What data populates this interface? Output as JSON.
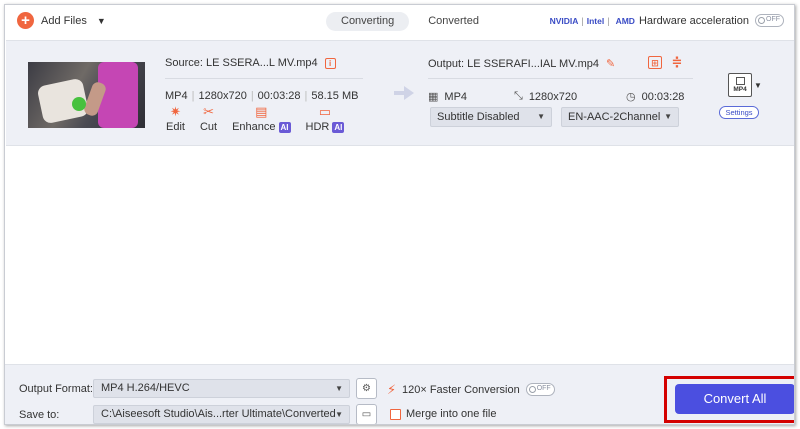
{
  "toolbar": {
    "add_files_label": "Add Files",
    "add_files_caret": "▼"
  },
  "tabs": [
    {
      "label": "Converting",
      "active": true
    },
    {
      "label": "Converted",
      "active": false
    }
  ],
  "hardware": {
    "nvidia": "NVIDIA",
    "intel": "Intel",
    "amd": "AMD",
    "label": "Hardware acceleration",
    "toggle_state": "OFF"
  },
  "file": {
    "source_label": "Source: LE SSERA...L MV.mp4",
    "format": "MP4",
    "resolution": "1280x720",
    "duration": "00:03:28",
    "size": "58.15 MB",
    "actions": [
      {
        "label": "Edit",
        "icon": "magic-wand-icon",
        "ai": false
      },
      {
        "label": "Cut",
        "icon": "scissors-icon",
        "ai": false
      },
      {
        "label": "Enhance",
        "icon": "enhance-icon",
        "ai": true
      },
      {
        "label": "HDR",
        "icon": "hdr-icon",
        "ai": true
      }
    ],
    "ai_badge": "AI",
    "output_label": "Output: LE SSERAFI...IAL MV.mp4",
    "output_format": "MP4",
    "output_resolution": "1280x720",
    "output_duration": "00:03:28",
    "subtitle": "Subtitle Disabled",
    "audio": "EN-AAC-2Channel",
    "format_badge": "MP4",
    "settings_label": "Settings"
  },
  "bottom": {
    "output_format_label": "Output Format:",
    "output_format_value": "MP4 H.264/HEVC",
    "save_to_label": "Save to:",
    "save_to_value": "C:\\Aiseesoft Studio\\Ais...rter Ultimate\\Converted",
    "faster_label": "120× Faster Conversion",
    "faster_toggle": "OFF",
    "merge_label": "Merge into one file",
    "convert_all_label": "Convert All"
  },
  "colors": {
    "accent": "#f0663f",
    "primary": "#4b4fe0",
    "highlight_border": "#d40000"
  }
}
